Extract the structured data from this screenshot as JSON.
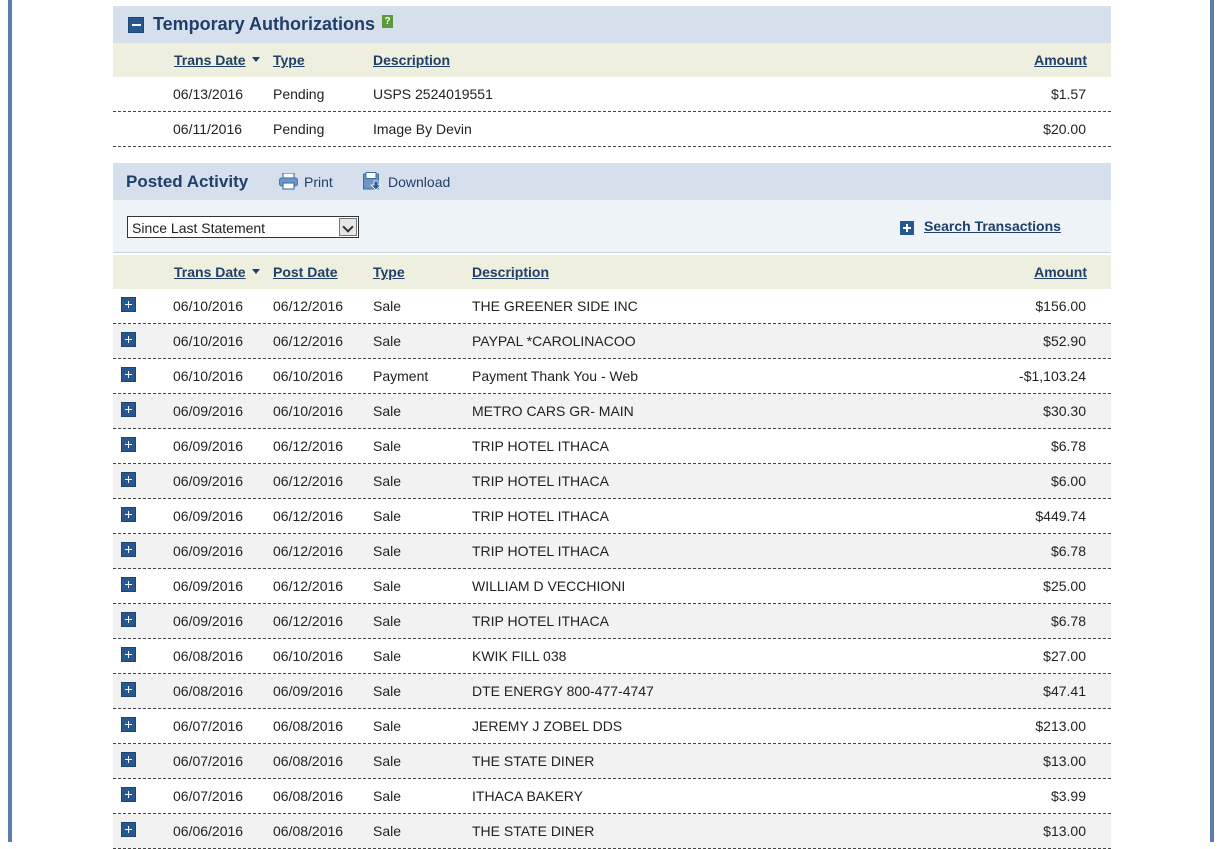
{
  "temp_auth": {
    "title": "Temporary Authorizations",
    "help_label": "?",
    "headers": {
      "trans_date": "Trans Date",
      "type": "Type",
      "description": "Description",
      "amount": "Amount"
    },
    "rows": [
      {
        "trans_date": "06/13/2016",
        "type": "Pending",
        "description": "USPS 2524019551",
        "amount": "$1.57"
      },
      {
        "trans_date": "06/11/2016",
        "type": "Pending",
        "description": "Image By Devin",
        "amount": "$20.00"
      }
    ]
  },
  "posted": {
    "title": "Posted Activity",
    "print_label": "Print",
    "download_label": "Download",
    "period_select": "Since Last Statement",
    "search_label": "Search Transactions",
    "headers": {
      "trans_date": "Trans Date",
      "post_date": "Post Date",
      "type": "Type",
      "description": "Description",
      "amount": "Amount"
    },
    "rows": [
      {
        "trans_date": "06/10/2016",
        "post_date": "06/12/2016",
        "type": "Sale",
        "description": "THE GREENER SIDE INC",
        "amount": "$156.00"
      },
      {
        "trans_date": "06/10/2016",
        "post_date": "06/12/2016",
        "type": "Sale",
        "description": "PAYPAL *CAROLINACOO",
        "amount": "$52.90"
      },
      {
        "trans_date": "06/10/2016",
        "post_date": "06/10/2016",
        "type": "Payment",
        "description": "Payment Thank You - Web",
        "amount": "-$1,103.24"
      },
      {
        "trans_date": "06/09/2016",
        "post_date": "06/10/2016",
        "type": "Sale",
        "description": "METRO CARS GR- MAIN",
        "amount": "$30.30"
      },
      {
        "trans_date": "06/09/2016",
        "post_date": "06/12/2016",
        "type": "Sale",
        "description": "TRIP HOTEL ITHACA",
        "amount": "$6.78"
      },
      {
        "trans_date": "06/09/2016",
        "post_date": "06/12/2016",
        "type": "Sale",
        "description": "TRIP HOTEL ITHACA",
        "amount": "$6.00"
      },
      {
        "trans_date": "06/09/2016",
        "post_date": "06/12/2016",
        "type": "Sale",
        "description": "TRIP HOTEL ITHACA",
        "amount": "$449.74"
      },
      {
        "trans_date": "06/09/2016",
        "post_date": "06/12/2016",
        "type": "Sale",
        "description": "TRIP HOTEL ITHACA",
        "amount": "$6.78"
      },
      {
        "trans_date": "06/09/2016",
        "post_date": "06/12/2016",
        "type": "Sale",
        "description": "WILLIAM D VECCHIONI",
        "amount": "$25.00"
      },
      {
        "trans_date": "06/09/2016",
        "post_date": "06/12/2016",
        "type": "Sale",
        "description": "TRIP HOTEL ITHACA",
        "amount": "$6.78"
      },
      {
        "trans_date": "06/08/2016",
        "post_date": "06/10/2016",
        "type": "Sale",
        "description": "KWIK FILL 038",
        "amount": "$27.00"
      },
      {
        "trans_date": "06/08/2016",
        "post_date": "06/09/2016",
        "type": "Sale",
        "description": "DTE ENERGY 800-477-4747",
        "amount": "$47.41"
      },
      {
        "trans_date": "06/07/2016",
        "post_date": "06/08/2016",
        "type": "Sale",
        "description": "JEREMY J ZOBEL DDS",
        "amount": "$213.00"
      },
      {
        "trans_date": "06/07/2016",
        "post_date": "06/08/2016",
        "type": "Sale",
        "description": "THE STATE DINER",
        "amount": "$13.00"
      },
      {
        "trans_date": "06/07/2016",
        "post_date": "06/08/2016",
        "type": "Sale",
        "description": "ITHACA BAKERY",
        "amount": "$3.99"
      },
      {
        "trans_date": "06/06/2016",
        "post_date": "06/08/2016",
        "type": "Sale",
        "description": "THE STATE DINER",
        "amount": "$13.00"
      }
    ]
  }
}
